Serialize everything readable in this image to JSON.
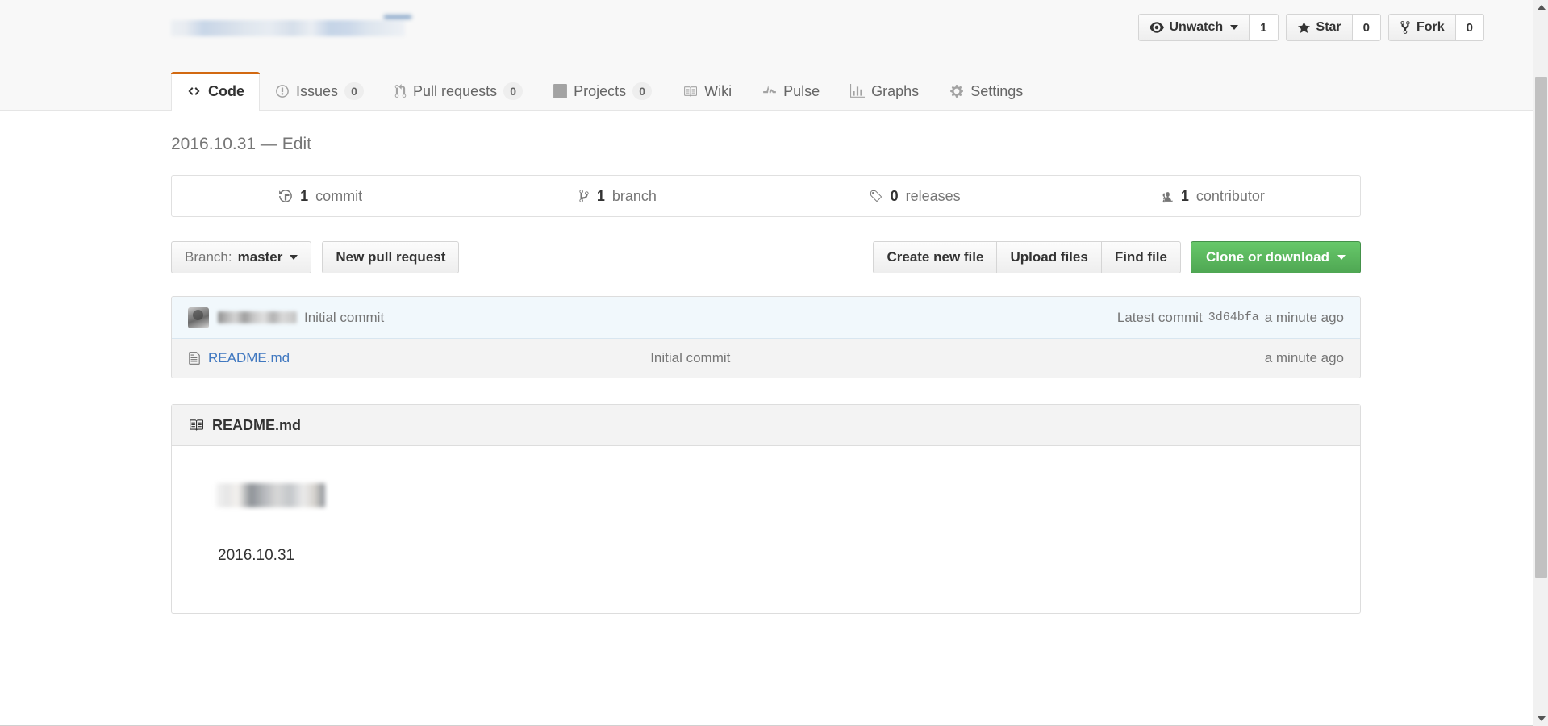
{
  "repo": {
    "title_redacted": true,
    "description": "2016.10.31 — Edit"
  },
  "social": {
    "unwatch_label": "Unwatch",
    "unwatch_count": "1",
    "star_label": "Star",
    "star_count": "0",
    "fork_label": "Fork",
    "fork_count": "0"
  },
  "tabs": [
    {
      "label": "Code",
      "icon": "code-icon",
      "count": null,
      "active": true
    },
    {
      "label": "Issues",
      "icon": "issue-opened-icon",
      "count": "0",
      "active": false
    },
    {
      "label": "Pull requests",
      "icon": "git-pull-request-icon",
      "count": "0",
      "active": false
    },
    {
      "label": "Projects",
      "icon": "project-icon",
      "count": "0",
      "active": false
    },
    {
      "label": "Wiki",
      "icon": "book-icon",
      "count": null,
      "active": false
    },
    {
      "label": "Pulse",
      "icon": "pulse-icon",
      "count": null,
      "active": false
    },
    {
      "label": "Graphs",
      "icon": "graph-icon",
      "count": null,
      "active": false
    },
    {
      "label": "Settings",
      "icon": "gear-icon",
      "count": null,
      "active": false
    }
  ],
  "stats": {
    "commits_num": "1",
    "commits_label": "commit",
    "branches_num": "1",
    "branches_label": "branch",
    "releases_num": "0",
    "releases_label": "releases",
    "contributors_num": "1",
    "contributors_label": "contributor"
  },
  "actions": {
    "branch_prefix": "Branch:",
    "branch_name": "master",
    "new_pull_request": "New pull request",
    "create_new_file": "Create new file",
    "upload_files": "Upload files",
    "find_file": "Find file",
    "clone_or_download": "Clone or download"
  },
  "latest_commit": {
    "author_redacted": true,
    "message": "Initial commit",
    "prefix": "Latest commit",
    "sha": "3d64bfa",
    "age": "a minute ago"
  },
  "files": [
    {
      "name": "README.md",
      "icon": "file-text-icon",
      "message": "Initial commit",
      "age": "a minute ago"
    }
  ],
  "readme": {
    "header_label": "README.md",
    "header_icon": "book-icon",
    "heading_redacted": true,
    "body_text": "2016.10.31"
  },
  "colors": {
    "accent_orange": "#d26911",
    "link_blue": "#4078c0",
    "clone_green": "#60b665",
    "commit_row_bg": "#f1f8fc",
    "muted_text": "#767676"
  }
}
